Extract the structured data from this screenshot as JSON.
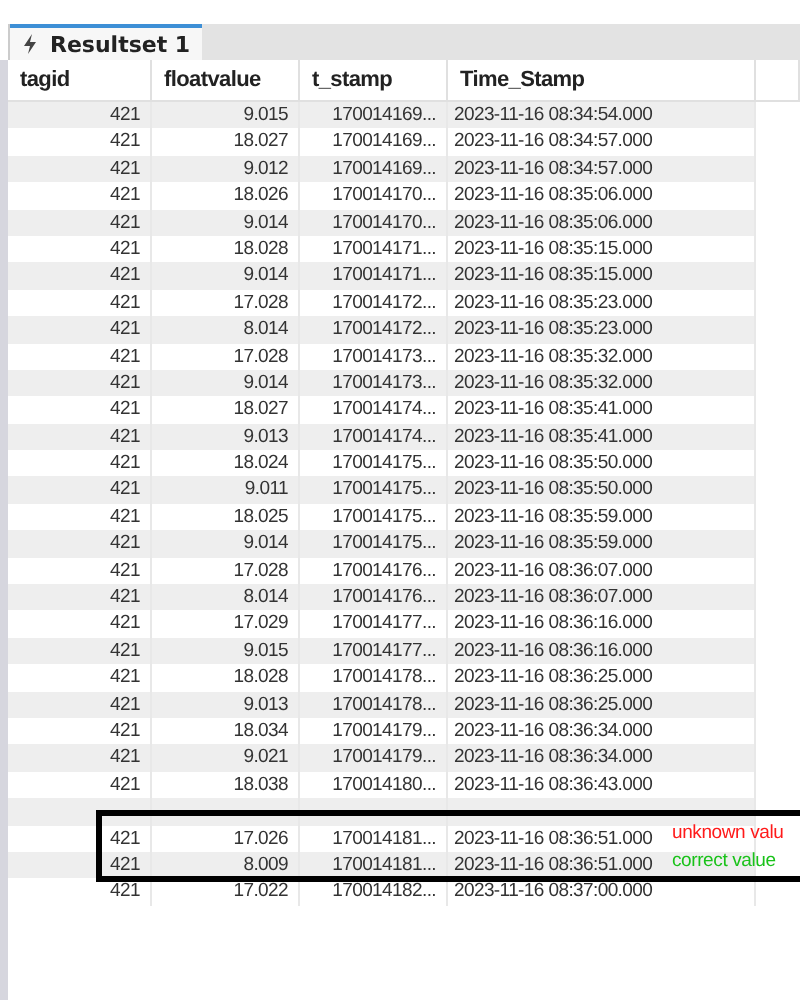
{
  "tabs": [
    {
      "label": "Resultset 1",
      "selected": true
    }
  ],
  "table": {
    "columns": [
      "tagid",
      "floatvalue",
      "t_stamp",
      "Time_Stamp"
    ],
    "rows": [
      [
        "421",
        "9.015",
        "170014169...",
        "2023-11-16 08:34:54.000"
      ],
      [
        "421",
        "18.027",
        "170014169...",
        "2023-11-16 08:34:57.000"
      ],
      [
        "421",
        "9.012",
        "170014169...",
        "2023-11-16 08:34:57.000"
      ],
      [
        "421",
        "18.026",
        "170014170...",
        "2023-11-16 08:35:06.000"
      ],
      [
        "421",
        "9.014",
        "170014170...",
        "2023-11-16 08:35:06.000"
      ],
      [
        "421",
        "18.028",
        "170014171...",
        "2023-11-16 08:35:15.000"
      ],
      [
        "421",
        "9.014",
        "170014171...",
        "2023-11-16 08:35:15.000"
      ],
      [
        "421",
        "17.028",
        "170014172...",
        "2023-11-16 08:35:23.000"
      ],
      [
        "421",
        "8.014",
        "170014172...",
        "2023-11-16 08:35:23.000"
      ],
      [
        "421",
        "17.028",
        "170014173...",
        "2023-11-16 08:35:32.000"
      ],
      [
        "421",
        "9.014",
        "170014173...",
        "2023-11-16 08:35:32.000"
      ],
      [
        "421",
        "18.027",
        "170014174...",
        "2023-11-16 08:35:41.000"
      ],
      [
        "421",
        "9.013",
        "170014174...",
        "2023-11-16 08:35:41.000"
      ],
      [
        "421",
        "18.024",
        "170014175...",
        "2023-11-16 08:35:50.000"
      ],
      [
        "421",
        "9.011",
        "170014175...",
        "2023-11-16 08:35:50.000"
      ],
      [
        "421",
        "18.025",
        "170014175...",
        "2023-11-16 08:35:59.000"
      ],
      [
        "421",
        "9.014",
        "170014175...",
        "2023-11-16 08:35:59.000"
      ],
      [
        "421",
        "17.028",
        "170014176...",
        "2023-11-16 08:36:07.000"
      ],
      [
        "421",
        "8.014",
        "170014176...",
        "2023-11-16 08:36:07.000"
      ],
      [
        "421",
        "17.029",
        "170014177...",
        "2023-11-16 08:36:16.000"
      ],
      [
        "421",
        "9.015",
        "170014177...",
        "2023-11-16 08:36:16.000"
      ],
      [
        "421",
        "18.028",
        "170014178...",
        "2023-11-16 08:36:25.000"
      ],
      [
        "421",
        "9.013",
        "170014178...",
        "2023-11-16 08:36:25.000"
      ],
      [
        "421",
        "18.034",
        "170014179...",
        "2023-11-16 08:36:34.000"
      ],
      [
        "421",
        "9.021",
        "170014179...",
        "2023-11-16 08:36:34.000"
      ],
      [
        "421",
        "18.038",
        "170014180...",
        "2023-11-16 08:36:43.000"
      ],
      [],
      [
        "421",
        "17.026",
        "170014181...",
        "2023-11-16 08:36:51.000"
      ],
      [
        "421",
        "8.009",
        "170014181...",
        "2023-11-16 08:36:51.000"
      ],
      [
        "421",
        "17.022",
        "170014182...",
        "2023-11-16 08:37:00.000"
      ]
    ]
  },
  "annotations": [
    {
      "text": "unknown valu",
      "color": "#ff1a1a"
    },
    {
      "text": "correct value",
      "color": "#19c219"
    }
  ]
}
